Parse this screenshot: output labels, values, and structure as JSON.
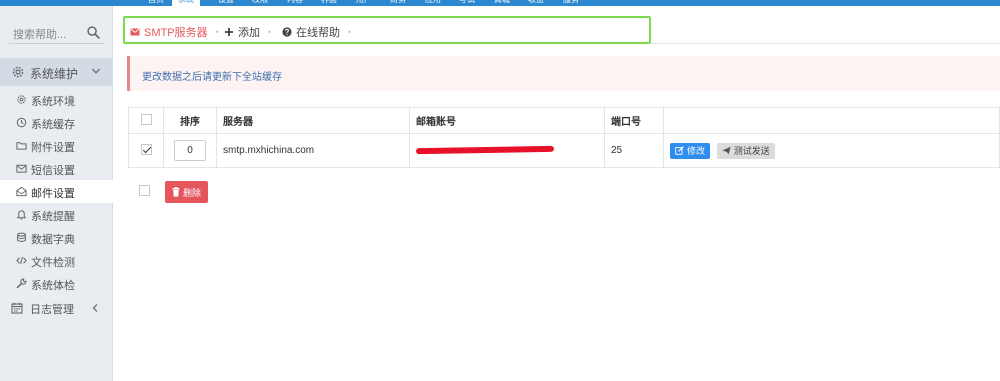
{
  "topnav": {
    "items": [
      "首页",
      "系统",
      "设置",
      "权限",
      "内容",
      "界面",
      "用户",
      "财务",
      "应用",
      "考试",
      "商城",
      "收益",
      "服务"
    ],
    "active_index": 1
  },
  "sidebar": {
    "search_placeholder": "搜索帮助...",
    "group_label": "系统维护",
    "items": [
      {
        "label": "系统环境",
        "icon": "gear-icon"
      },
      {
        "label": "系统缓存",
        "icon": "clock-icon"
      },
      {
        "label": "附件设置",
        "icon": "folder-icon"
      },
      {
        "label": "短信设置",
        "icon": "envelope-icon"
      },
      {
        "label": "邮件设置",
        "icon": "mail-open-icon"
      },
      {
        "label": "系统提醒",
        "icon": "bell-icon"
      },
      {
        "label": "数据字典",
        "icon": "database-icon"
      },
      {
        "label": "文件检测",
        "icon": "code-icon"
      },
      {
        "label": "系统体检",
        "icon": "wrench-icon"
      }
    ],
    "active_index": 4,
    "group2_label": "日志管理"
  },
  "tabs": {
    "smtp": "SMTP服务器",
    "add": "添加",
    "help": "在线帮助",
    "sep": "⬩"
  },
  "alert": {
    "text": "更改数据之后请更新下全站缓存"
  },
  "table": {
    "headers": {
      "order": "排序",
      "server": "服务器",
      "account": "邮箱账号",
      "port": "端口号"
    },
    "rows": [
      {
        "checked": true,
        "order": "0",
        "server": "smtp.mxhichina.com",
        "account": "",
        "port": "25"
      }
    ],
    "edit_label": "修改",
    "test_label": "测试发送"
  },
  "delete_label": "删除",
  "colors": {
    "nav_blue": "#2a87d0",
    "accent_red": "#e35b5b",
    "highlight_green": "#7edb4f",
    "edit_blue": "#2e8ded",
    "delete_red": "#e4565b"
  }
}
